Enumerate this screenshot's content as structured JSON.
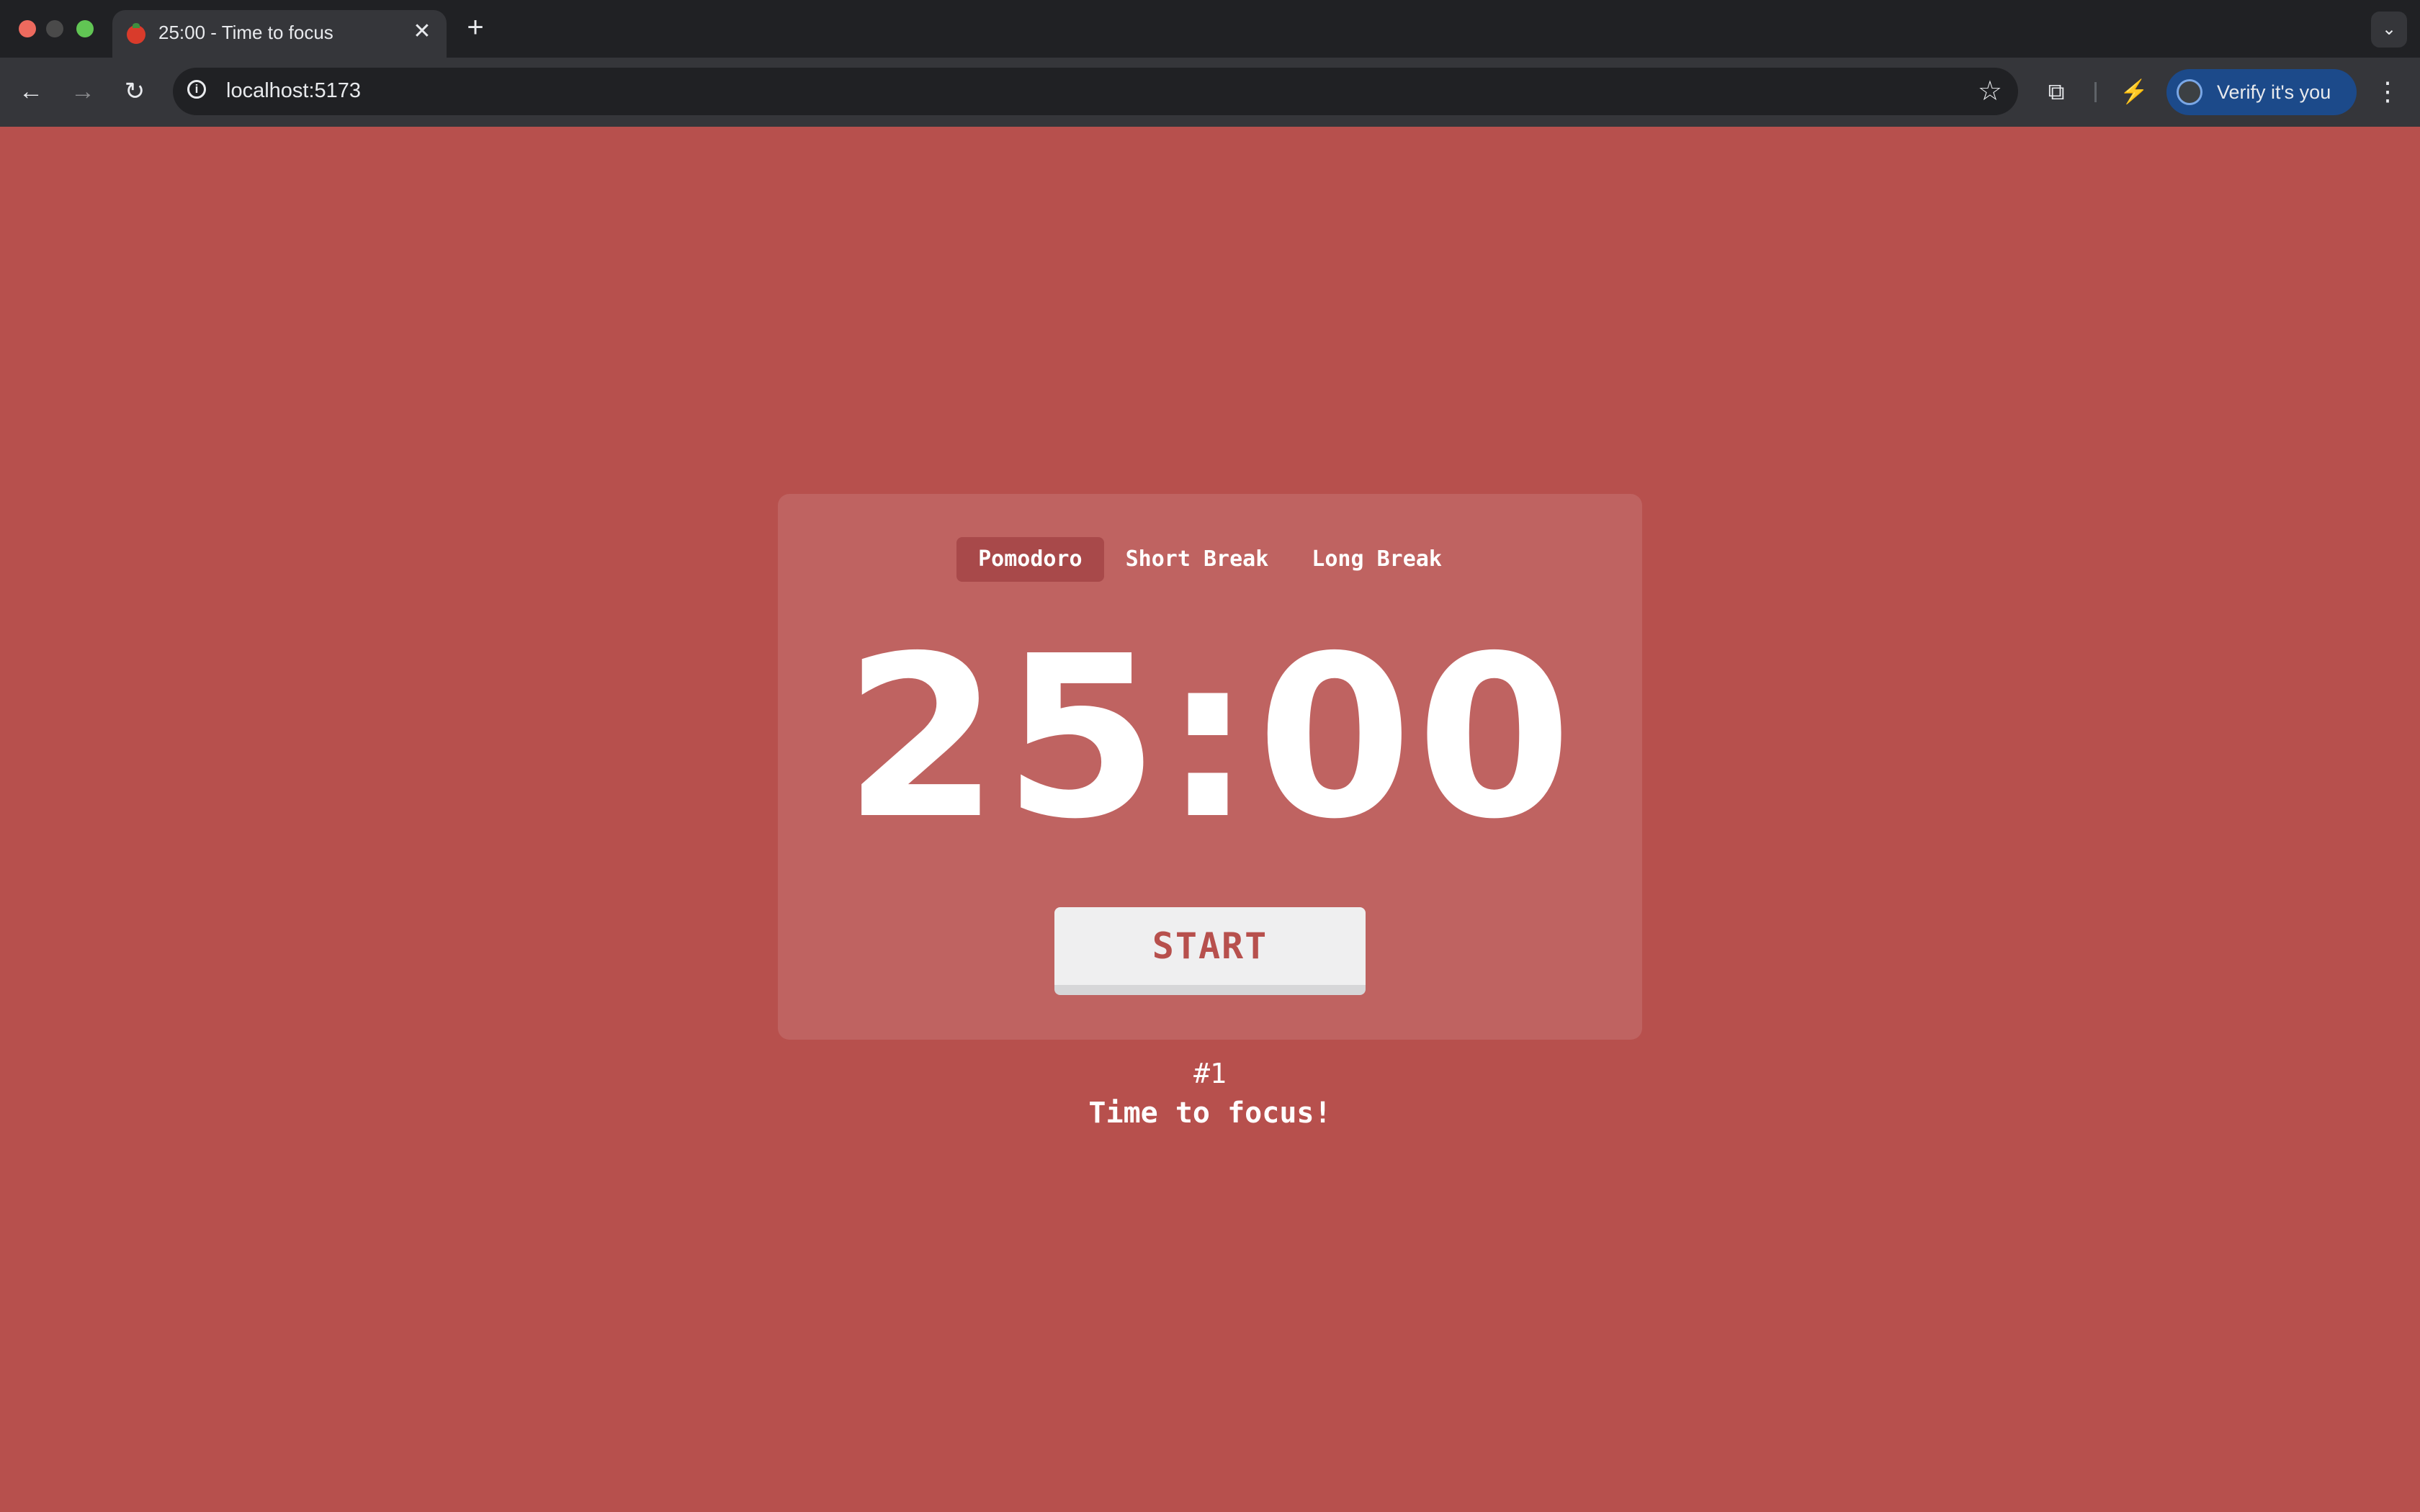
{
  "browser": {
    "tab_title": "25:00 - Time to focus",
    "close_tab": "✕",
    "new_tab": "+",
    "tab_search": "⌄",
    "url": "localhost:5173",
    "profile_chip": "Verify it's you"
  },
  "app": {
    "modes": [
      "Pomodoro",
      "Short Break",
      "Long Break"
    ],
    "active_mode": "Pomodoro",
    "timer": "25:00",
    "start_label": "START",
    "round": "#1",
    "message": "Time to focus!",
    "colors": {
      "background": "#b7504d",
      "card": "#bf6361",
      "active_tab": "#a8494a",
      "button": "#efeff0"
    }
  }
}
